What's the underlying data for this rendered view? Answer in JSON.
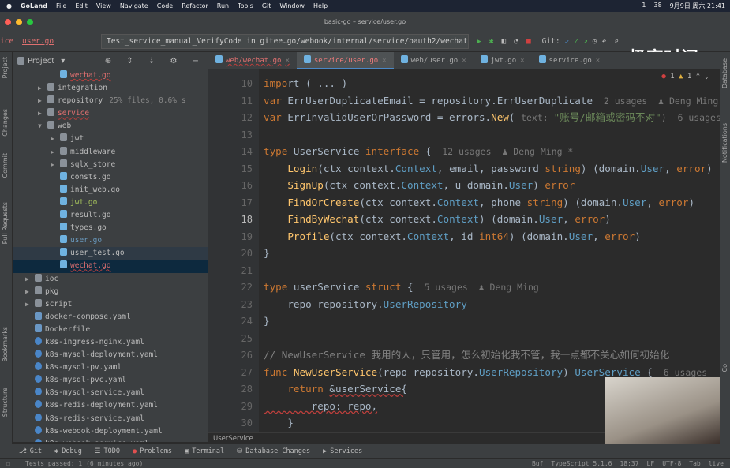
{
  "menubar": {
    "app": "GoLand",
    "items": [
      "File",
      "Edit",
      "View",
      "Navigate",
      "Code",
      "Refactor",
      "Run",
      "Tools",
      "Git",
      "Window",
      "Help"
    ],
    "clock": "9月9日 周六 21:41",
    "badges": [
      "1",
      "38"
    ]
  },
  "window": {
    "title": "basic-go – service/user.go"
  },
  "toolbar": {
    "breadcrumb_prev": "ice",
    "breadcrumb_file": "user.go",
    "run_config": "Test_service_manual_VerifyCode in gitee…go/webook/internal/service/oauth2/wechat",
    "git_label": "Git:"
  },
  "watermark": "极客时间",
  "left_strip": [
    "Project",
    "Changes",
    "Commit",
    "Pull Requests",
    "Bookmarks",
    "Structure"
  ],
  "right_strip": [
    "Database",
    "Notifications",
    "Co"
  ],
  "project": {
    "title": "Project",
    "tree": [
      {
        "label": "wechat.go",
        "depth": 3,
        "type": "go",
        "err": true
      },
      {
        "label": "integration",
        "depth": 2,
        "type": "folder",
        "arrow": "▶"
      },
      {
        "label": "repository",
        "depth": 2,
        "type": "folder",
        "arrow": "▶",
        "note": "25% files, 0.6% s"
      },
      {
        "label": "service",
        "depth": 2,
        "type": "folder",
        "arrow": "▶",
        "err": true
      },
      {
        "label": "web",
        "depth": 2,
        "type": "folder",
        "arrow": "▼"
      },
      {
        "label": "jwt",
        "depth": 3,
        "type": "folder",
        "arrow": "▶"
      },
      {
        "label": "middleware",
        "depth": 3,
        "type": "folder",
        "arrow": "▶"
      },
      {
        "label": "sqlx_store",
        "depth": 3,
        "type": "folder",
        "arrow": "▶"
      },
      {
        "label": "consts.go",
        "depth": 3,
        "type": "go"
      },
      {
        "label": "init_web.go",
        "depth": 3,
        "type": "go"
      },
      {
        "label": "jwt.go",
        "depth": 3,
        "type": "go",
        "color": "#a5c25c"
      },
      {
        "label": "result.go",
        "depth": 3,
        "type": "go"
      },
      {
        "label": "types.go",
        "depth": 3,
        "type": "go"
      },
      {
        "label": "user.go",
        "depth": 3,
        "type": "go",
        "color": "#6897bb"
      },
      {
        "label": "user_test.go",
        "depth": 3,
        "type": "go",
        "sel2": true
      },
      {
        "label": "wechat.go",
        "depth": 3,
        "type": "go",
        "err": true,
        "sel": true
      },
      {
        "label": "ioc",
        "depth": 1,
        "type": "folder",
        "arrow": "▶"
      },
      {
        "label": "pkg",
        "depth": 1,
        "type": "folder",
        "arrow": "▶"
      },
      {
        "label": "script",
        "depth": 1,
        "type": "folder",
        "arrow": "▶"
      },
      {
        "label": "docker-compose.yaml",
        "depth": 1,
        "type": "docker"
      },
      {
        "label": "Dockerfile",
        "depth": 1,
        "type": "docker"
      },
      {
        "label": "k8s-ingress-nginx.yaml",
        "depth": 1,
        "type": "yaml"
      },
      {
        "label": "k8s-mysql-deployment.yaml",
        "depth": 1,
        "type": "yaml"
      },
      {
        "label": "k8s-mysql-pv.yaml",
        "depth": 1,
        "type": "yaml"
      },
      {
        "label": "k8s-mysql-pvc.yaml",
        "depth": 1,
        "type": "yaml"
      },
      {
        "label": "k8s-mysql-service.yaml",
        "depth": 1,
        "type": "yaml"
      },
      {
        "label": "k8s-redis-deployment.yaml",
        "depth": 1,
        "type": "yaml"
      },
      {
        "label": "k8s-redis-service.yaml",
        "depth": 1,
        "type": "yaml"
      },
      {
        "label": "k8s-webook-deployment.yaml",
        "depth": 1,
        "type": "yaml"
      },
      {
        "label": "k8s-webook-service.yaml",
        "depth": 1,
        "type": "yaml"
      }
    ]
  },
  "tabs": [
    {
      "label": "web/wechat.go",
      "state": "err"
    },
    {
      "label": "service/user.go",
      "state": "active"
    },
    {
      "label": "web/user.go"
    },
    {
      "label": "jwt.go"
    },
    {
      "label": "service.go"
    }
  ],
  "inspections": {
    "errors": "1",
    "warnings": "1"
  },
  "editor": {
    "lines": [
      {
        "n": "10",
        "t": [
          [
            "impo",
            "kw"
          ],
          [
            "rt ( ... )",
            "id"
          ]
        ]
      },
      {
        "n": "11",
        "t": [
          [
            "var ",
            "kw"
          ],
          [
            "ErrUserDuplicateEmail = repository.ErrUserDuplicate",
            "id"
          ],
          [
            "  2 usages  ♟ Deng Ming",
            "hint"
          ]
        ]
      },
      {
        "n": "12",
        "t": [
          [
            "var ",
            "kw"
          ],
          [
            "ErrInvalidUserOrPassword = errors.",
            "id"
          ],
          [
            "New",
            "fn"
          ],
          [
            "( ",
            "id"
          ],
          [
            "text: ",
            "hint"
          ],
          [
            "\"账号/邮箱或密码不对\"",
            "st"
          ],
          [
            ")  6 usages",
            "hint"
          ]
        ]
      },
      {
        "n": "13",
        "t": []
      },
      {
        "n": "14",
        "t": [
          [
            "type ",
            "kw"
          ],
          [
            "UserService ",
            "id"
          ],
          [
            "interface",
            "kw"
          ],
          [
            " {",
            "id"
          ],
          [
            "  12 usages  ♟ Deng Ming *",
            "hint"
          ]
        ]
      },
      {
        "n": "15",
        "t": [
          [
            "    ",
            "id"
          ],
          [
            "Login",
            "fn"
          ],
          [
            "(ctx context.",
            "id"
          ],
          [
            "Context",
            "ifc"
          ],
          [
            ", email, password ",
            "id"
          ],
          [
            "string",
            "kw"
          ],
          [
            ") (domain.",
            "id"
          ],
          [
            "User",
            "ifc"
          ],
          [
            ", ",
            "id"
          ],
          [
            "error",
            "kw"
          ],
          [
            ")",
            "id"
          ]
        ]
      },
      {
        "n": "16",
        "t": [
          [
            "    ",
            "id"
          ],
          [
            "SignUp",
            "fn"
          ],
          [
            "(ctx context.",
            "id"
          ],
          [
            "Context",
            "ifc"
          ],
          [
            ", u domain.",
            "id"
          ],
          [
            "User",
            "ifc"
          ],
          [
            ") ",
            "id"
          ],
          [
            "error",
            "kw"
          ]
        ]
      },
      {
        "n": "17",
        "t": [
          [
            "    ",
            "id"
          ],
          [
            "FindOrCreate",
            "fn"
          ],
          [
            "(ctx context.",
            "id"
          ],
          [
            "Context",
            "ifc"
          ],
          [
            ", phone ",
            "id"
          ],
          [
            "string",
            "kw"
          ],
          [
            ") (domain.",
            "id"
          ],
          [
            "User",
            "ifc"
          ],
          [
            ", ",
            "id"
          ],
          [
            "error",
            "kw"
          ],
          [
            ")",
            "id"
          ]
        ]
      },
      {
        "n": "18",
        "t": [
          [
            "    ",
            "id"
          ],
          [
            "FindByWechat",
            "fn"
          ],
          [
            "(ctx context.",
            "id"
          ],
          [
            "Context",
            "ifc"
          ],
          [
            ") (domain.",
            "id"
          ],
          [
            "User",
            "ifc"
          ],
          [
            ", ",
            "id"
          ],
          [
            "error",
            "kw"
          ],
          [
            ")",
            "id"
          ]
        ]
      },
      {
        "n": "19",
        "t": [
          [
            "    ",
            "id"
          ],
          [
            "Profile",
            "fn"
          ],
          [
            "(ctx context.",
            "id"
          ],
          [
            "Context",
            "ifc"
          ],
          [
            ", id ",
            "id"
          ],
          [
            "int64",
            "kw"
          ],
          [
            ") (domain.",
            "id"
          ],
          [
            "User",
            "ifc"
          ],
          [
            ", ",
            "id"
          ],
          [
            "error",
            "kw"
          ],
          [
            ")",
            "id"
          ]
        ]
      },
      {
        "n": "20",
        "t": [
          [
            "}",
            "id"
          ]
        ]
      },
      {
        "n": "21",
        "t": []
      },
      {
        "n": "22",
        "t": [
          [
            "type ",
            "kw"
          ],
          [
            "userService ",
            "id"
          ],
          [
            "struct",
            "kw"
          ],
          [
            " {",
            "id"
          ],
          [
            "  5 usages  ♟ Deng Ming",
            "hint"
          ]
        ]
      },
      {
        "n": "23",
        "t": [
          [
            "    repo repository.",
            "id"
          ],
          [
            "UserRepository",
            "ifc"
          ]
        ]
      },
      {
        "n": "24",
        "t": [
          [
            "}",
            "id"
          ]
        ]
      },
      {
        "n": "25",
        "t": []
      },
      {
        "n": "26",
        "t": [
          [
            "// NewUserService 我用的人，只管用，怎么初始化我不管，我一点都不关心如何初始化",
            "cm"
          ]
        ]
      },
      {
        "n": "27",
        "t": [
          [
            "func ",
            "kw"
          ],
          [
            "NewUserService",
            "fn"
          ],
          [
            "(repo repository.",
            "id"
          ],
          [
            "UserRepository",
            "ifc"
          ],
          [
            ") ",
            "id"
          ],
          [
            "UserService",
            "ifc"
          ],
          [
            " {",
            "id"
          ],
          [
            "  6 usages",
            "hint"
          ]
        ]
      },
      {
        "n": "28",
        "t": [
          [
            "    ",
            "id"
          ],
          [
            "return ",
            "kw"
          ],
          [
            "&userService{",
            "id"
          ]
        ]
      },
      {
        "n": "29",
        "t": [
          [
            "        repo: repo,",
            "id"
          ]
        ]
      },
      {
        "n": "30",
        "t": [
          [
            "    }",
            "id"
          ]
        ]
      }
    ]
  },
  "breadcrumb": "UserService",
  "bottom_tabs": [
    "Git",
    "Debug",
    "TODO",
    "Problems",
    "Terminal",
    "Database Changes",
    "Services"
  ],
  "status": {
    "message": "Tests passed: 1 (6 minutes ago)",
    "right": [
      "Buf",
      "TypeScript 5.1.6",
      "18:37",
      "LF",
      "UTF-8",
      "Tab",
      "live"
    ]
  }
}
